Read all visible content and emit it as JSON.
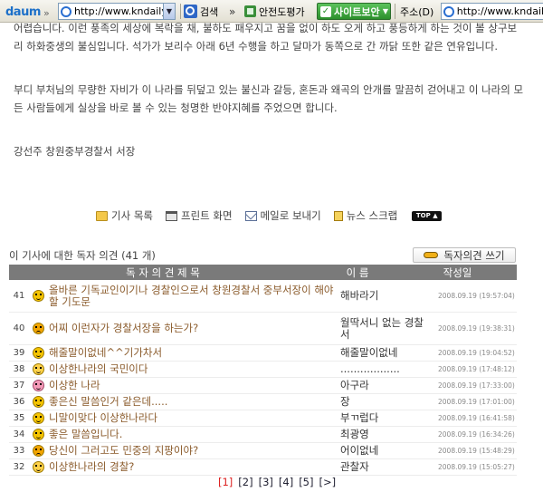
{
  "toolbar": {
    "brand": "daum",
    "url1": "http://www.kndaily",
    "search": "검색",
    "safe_eval": "안전도평가",
    "site_security": "사이트보안",
    "address_label": "주소(D)",
    "url2": "http://www.kndaily"
  },
  "article": {
    "p1": "어렵습니다. 이런 풍족의 세상에 복락을 채, 불하도 패우지고 꿈을 없이 하도 오게 하고 풍등하게 하는 것이 볼 상구보리 하화중생의 불심입니다. 석가가 보리수 아래 6년 수행을 하고 달마가 동쪽으로 간 까닭 또한 같은 연유입니다.",
    "p2": "부디 부처님의 무량한 자비가 이 나라를 뒤덮고 있는 불신과 갈등, 혼돈과 왜곡의 안개를 말끔히 걷어내고 이 나라의 모든 사람들에게 실상을 바로 볼 수 있는 청명한 반야지혜를 주었으면 합니다.",
    "signature": "강선주 창원중부경찰서 서장"
  },
  "actions": {
    "list": "기사 목록",
    "print": "프린트 화면",
    "mail": "메일로 보내기",
    "scrap": "뉴스 스크랩",
    "top": "TOP"
  },
  "comments": {
    "heading": "이 기사에 대한 독자 의견 (41 개)",
    "write_button": "독자의견 쓰기",
    "col_title": "독 자 의 견 제 목",
    "col_name": "이 름",
    "col_date": "작성일",
    "rows": [
      {
        "num": "41",
        "title": "올바른 기독교인이기나 경찰인으로서 창원경찰서 중부서장이 해야 할 기도문",
        "name": "해바라기",
        "date": "2008.09.19 (19:57:04)",
        "face": "smile"
      },
      {
        "num": "40",
        "title": "어찌 이런자가 경찰서장을 하는가?",
        "name": "월딱서니 없는 경찰서",
        "date": "2008.09.19 (19:38:31)",
        "face": "angry"
      },
      {
        "num": "39",
        "title": "해줄말이없네^^기가차서",
        "name": "해줄말이없네",
        "date": "2008.09.19 (19:04:52)",
        "face": "smile"
      },
      {
        "num": "38",
        "title": "이상한나라의 국민이다",
        "name": "..................",
        "date": "2008.09.19 (17:48:12)",
        "face": "sad"
      },
      {
        "num": "37",
        "title": "이상한 나라",
        "name": "아구라",
        "date": "2008.09.19 (17:33:00)",
        "face": "pink"
      },
      {
        "num": "36",
        "title": "좋은신 말씀인거 같은데.....",
        "name": "장",
        "date": "2008.09.19 (17:01:00)",
        "face": "smile"
      },
      {
        "num": "35",
        "title": "니말이맞다 이상한나라다",
        "name": "부ㄲ럽다",
        "date": "2008.09.19 (16:41:58)",
        "face": "smile"
      },
      {
        "num": "34",
        "title": "좋은 말씀입니다.",
        "name": "최광영",
        "date": "2008.09.19 (16:34:26)",
        "face": "smile"
      },
      {
        "num": "33",
        "title": "당신이 그러고도 민중의 지팡이야?",
        "name": "어이없네",
        "date": "2008.09.19 (15:48:29)",
        "face": "angry"
      },
      {
        "num": "32",
        "title": "이상한나라의 경찰?",
        "name": "관찰자",
        "date": "2008.09.19 (15:05:27)",
        "face": "tear"
      }
    ]
  },
  "pager": [
    "[1]",
    "[2]",
    "[3]",
    "[4]",
    "[5]",
    "[>]"
  ],
  "colors": {
    "header_bg": "#7a7a7a",
    "title_text": "#8a5a2a",
    "current_page": "#dd2222",
    "site_security_bg": "#2c8f2c"
  }
}
